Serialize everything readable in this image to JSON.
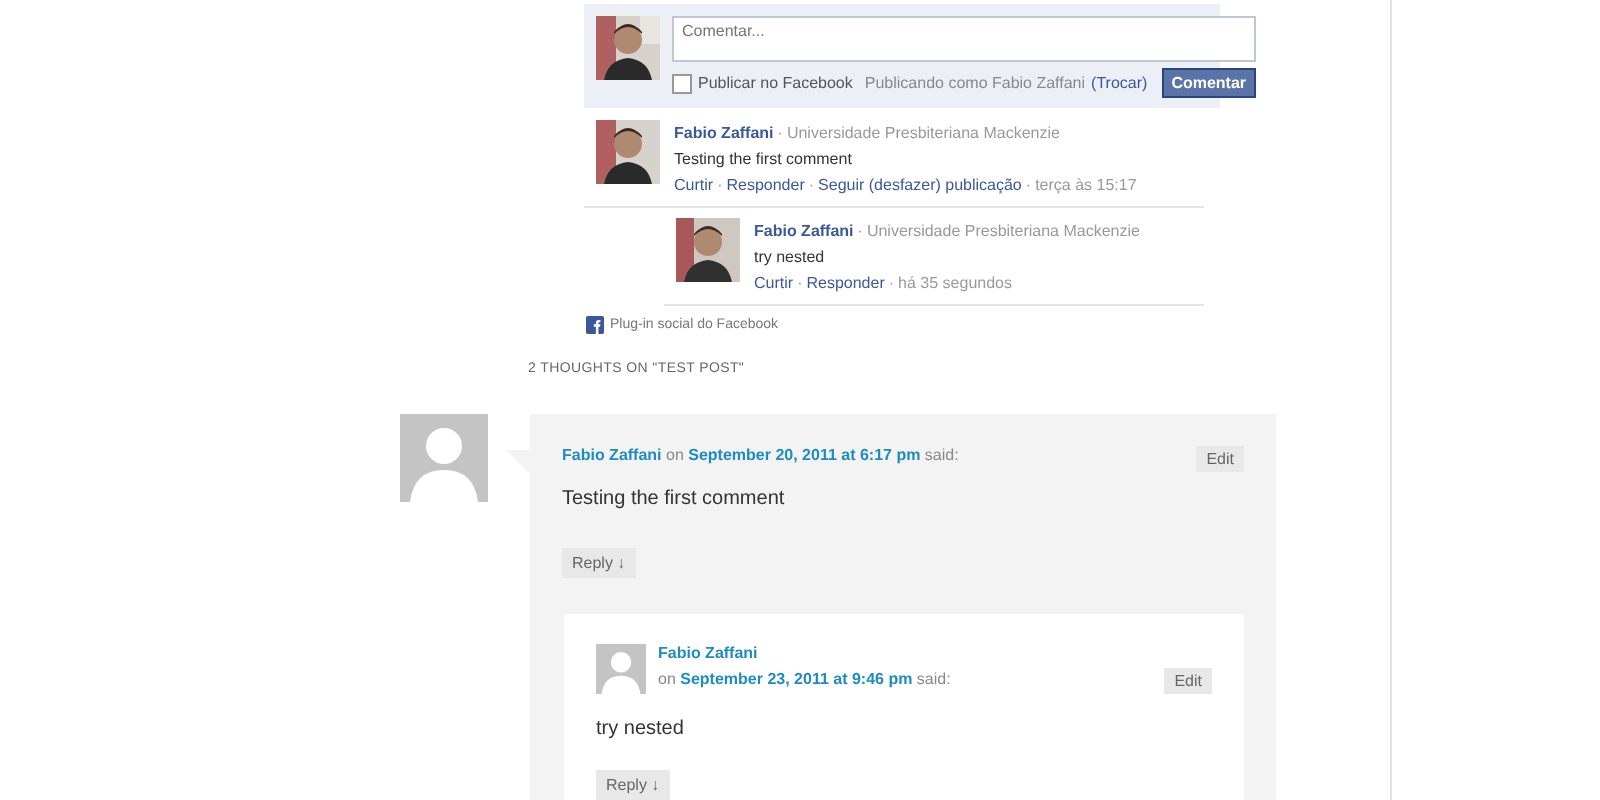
{
  "facebook_plugin": {
    "comment_field": {
      "placeholder": "Comentar..."
    },
    "publish_checkbox": {
      "label": "Publicar no Facebook",
      "checked": false
    },
    "posting_as": "Publicando como Fabio Zaffani",
    "switch_link": "(Trocar)",
    "submit_button": "Comentar",
    "separator": "·",
    "comments": [
      {
        "author": "Fabio Zaffani",
        "affiliation": "Universidade Presbiteriana Mackenzie",
        "text": "Testing the first comment",
        "actions": [
          "Curtir",
          "Responder",
          "Seguir (desfazer) publicação"
        ],
        "time": "terça às 15:17",
        "replies": [
          {
            "author": "Fabio Zaffani",
            "affiliation": "Universidade Presbiteriana Mackenzie",
            "text": "try nested",
            "actions": [
              "Curtir",
              "Responder"
            ],
            "time": "há 35 segundos"
          }
        ]
      }
    ],
    "footer": "Plug-in social do Facebook"
  },
  "comments_heading": "2 THOUGHTS ON \"TEST POST\"",
  "comments": [
    {
      "author": "Fabio Zaffani",
      "on": "on",
      "date": "September 20, 2011 at 6:17 pm",
      "said": "said:",
      "edit": "Edit",
      "text": "Testing the first comment",
      "reply": "Reply ↓",
      "children": [
        {
          "author": "Fabio Zaffani",
          "on": "on",
          "date": "September 23, 2011 at 9:46 pm",
          "said": "said:",
          "edit": "Edit",
          "text": "try nested",
          "reply": "Reply ↓"
        }
      ]
    }
  ]
}
